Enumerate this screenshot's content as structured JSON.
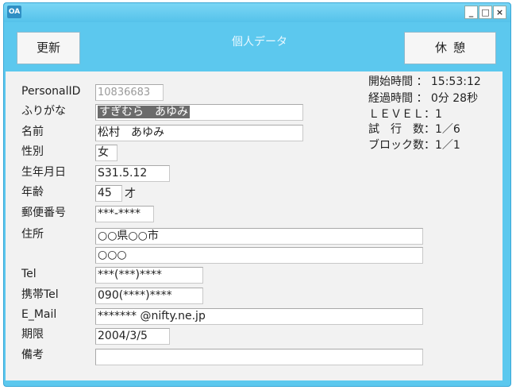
{
  "window": {
    "logo_text": "OA"
  },
  "header": {
    "update_label": "更新",
    "title": "個人データ",
    "rest_label": "休憩"
  },
  "form": {
    "personal_id": {
      "label": "PersonalID",
      "value": "10836683"
    },
    "furigana": {
      "label": "ふりがな",
      "value": "すぎむら　あゆみ"
    },
    "name": {
      "label": "名前",
      "value": "松村　あゆみ"
    },
    "gender": {
      "label": "性別",
      "value": "女"
    },
    "birthdate": {
      "label": "生年月日",
      "value": "S31.5.12"
    },
    "age": {
      "label": "年齢",
      "value": "45",
      "unit": "才"
    },
    "postal": {
      "label": "郵便番号",
      "value": "***-****"
    },
    "address": {
      "label": "住所",
      "line1": "○○県○○市",
      "line2": "○○○"
    },
    "tel": {
      "label": "Tel",
      "value": "***(***)****"
    },
    "mobile": {
      "label": "携帯Tel",
      "value": "090(****)****"
    },
    "email": {
      "label": "E_Mail",
      "value": "******* @nifty.ne.jp"
    },
    "deadline": {
      "label": "期限",
      "value": "2004/3/5"
    },
    "notes": {
      "label": "備考",
      "value": ""
    }
  },
  "info": {
    "start_time": "開始時間 ： 15:53:12",
    "elapsed": "経過時間 ： 0分 28秒",
    "level": "ＬＥＶＥＬ：1",
    "trials": "試　行　数：1／6",
    "blocks": "ブロック数：1／1"
  }
}
